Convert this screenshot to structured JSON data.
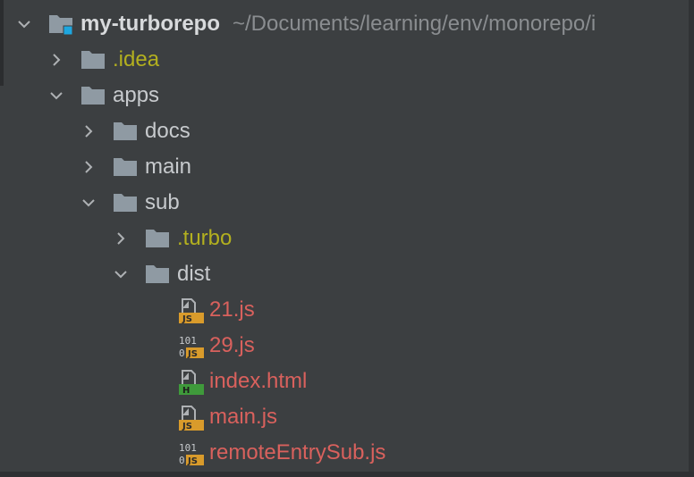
{
  "project_tree": {
    "root": {
      "name": "my-turborepo",
      "path": "~/Documents/learning/env/monorepo/i"
    },
    "nodes": [
      {
        "name": ".idea",
        "kind": "folder",
        "expanded": false,
        "depth": 1,
        "status": "excluded"
      },
      {
        "name": "apps",
        "kind": "folder",
        "expanded": true,
        "depth": 1,
        "status": "normal"
      },
      {
        "name": "docs",
        "kind": "folder",
        "expanded": false,
        "depth": 2,
        "status": "normal"
      },
      {
        "name": "main",
        "kind": "folder",
        "expanded": false,
        "depth": 2,
        "status": "normal"
      },
      {
        "name": "sub",
        "kind": "folder",
        "expanded": true,
        "depth": 2,
        "status": "normal"
      },
      {
        "name": ".turbo",
        "kind": "folder",
        "expanded": false,
        "depth": 3,
        "status": "excluded"
      },
      {
        "name": "dist",
        "kind": "folder",
        "expanded": true,
        "depth": 3,
        "status": "normal"
      },
      {
        "name": "21.js",
        "kind": "file",
        "icon": "javascript-file-icon",
        "depth": 4,
        "status": "untracked"
      },
      {
        "name": "29.js",
        "kind": "file",
        "icon": "binary-javascript-file-icon",
        "depth": 4,
        "status": "untracked"
      },
      {
        "name": "index.html",
        "kind": "file",
        "icon": "html-file-icon",
        "depth": 4,
        "status": "untracked"
      },
      {
        "name": "main.js",
        "kind": "file",
        "icon": "javascript-file-icon",
        "depth": 4,
        "status": "untracked"
      },
      {
        "name": "remoteEntrySub.js",
        "kind": "file",
        "icon": "binary-javascript-file-icon",
        "depth": 4,
        "status": "untracked"
      }
    ]
  },
  "colors": {
    "background": "#3c3f41",
    "text": "#c7cacd",
    "excluded": "#b3b01f",
    "untracked": "#d9615d",
    "folder": "#8f9aa3",
    "module_marker": "#1ea7e0",
    "js_badge": "#d99b2b",
    "html_badge": "#3f9a3b"
  }
}
